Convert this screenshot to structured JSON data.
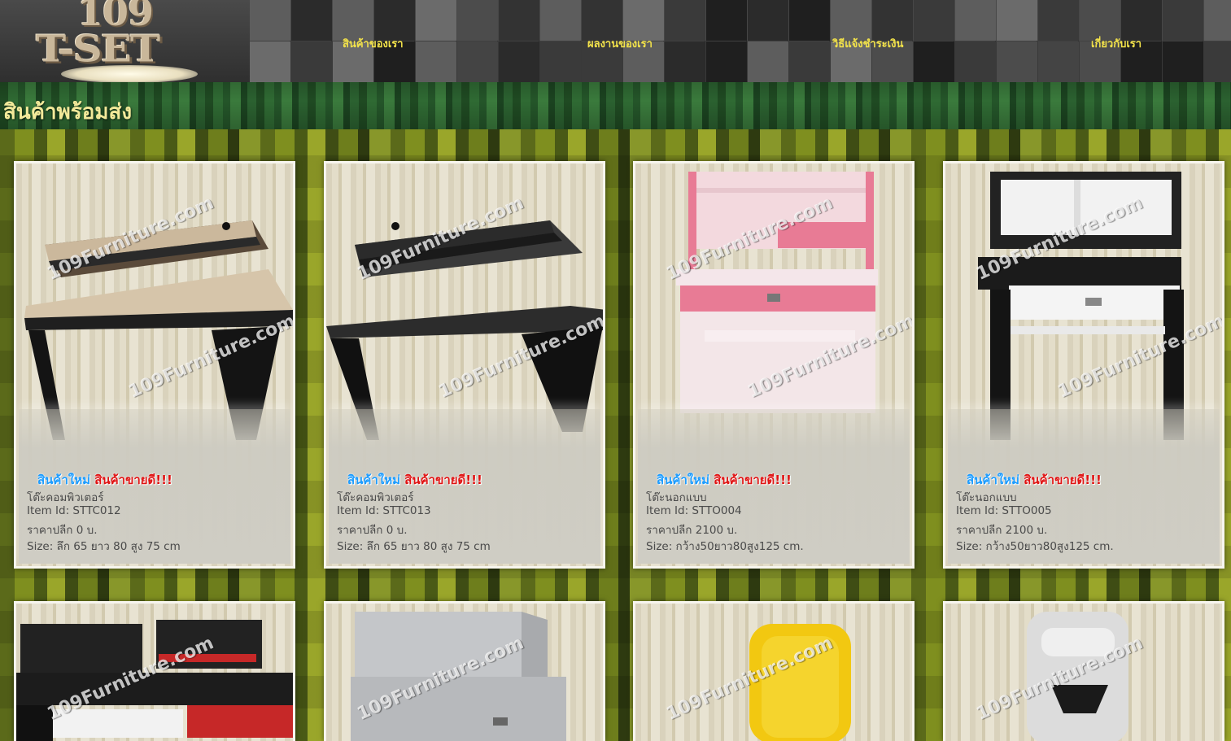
{
  "logo": {
    "number": "109",
    "word": "T-SET"
  },
  "nav": [
    {
      "label": "สินค้าของเรา"
    },
    {
      "label": "ผลงานของเรา"
    },
    {
      "label": "วิธีแจ้งชำระเงิน"
    },
    {
      "label": "เกี่ยวกับเรา"
    }
  ],
  "page_title": "สินค้าพร้อมส่ง",
  "watermark": "109Furniture.com",
  "badge": {
    "new": "สินค้าใหม่",
    "best": "สินค้าขายดี!!!"
  },
  "products": [
    {
      "name": "โต๊ะคอมพิวเตอร์",
      "item_id": "Item Id: STTC012",
      "price": "ราคาปลีก 0 บ.",
      "size": "Size: ลึก 65 ยาว 80 สูง 75 cm"
    },
    {
      "name": "โต๊ะคอมพิวเตอร์",
      "item_id": "Item Id: STTC013",
      "price": "ราคาปลีก 0 บ.",
      "size": "Size: ลึก 65 ยาว 80 สูง 75 cm"
    },
    {
      "name": "โต๊ะนอกแบบ",
      "item_id": "Item Id: STTO004",
      "price": "ราคาปลีก 2100 บ.",
      "size": "Size: กว้าง50ยาว80สูง125 cm."
    },
    {
      "name": "โต๊ะนอกแบบ",
      "item_id": "Item Id: STTO005",
      "price": "ราคาปลีก 2100 บ.",
      "size": "Size: กว้าง50ยาว80สูง125 cm."
    }
  ]
}
